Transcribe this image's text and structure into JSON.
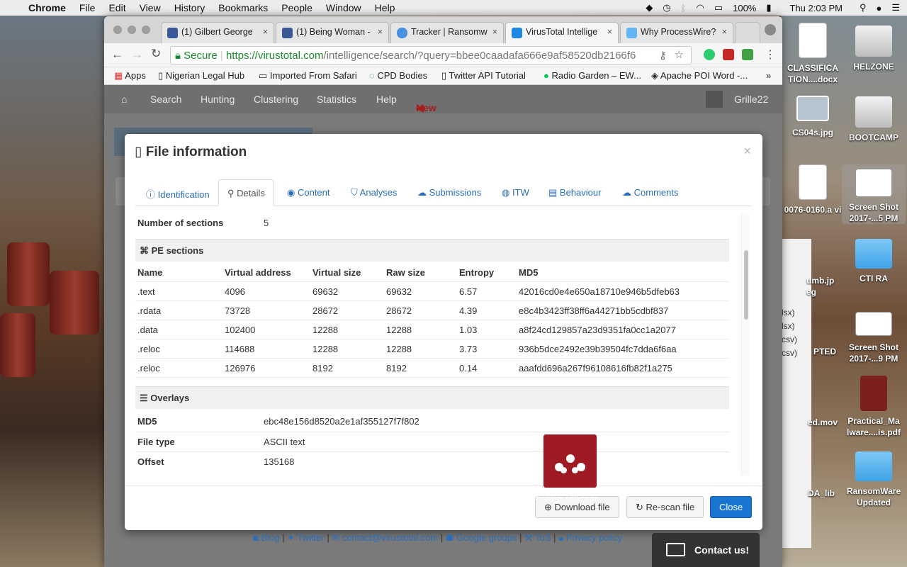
{
  "menubar": {
    "app": "Chrome",
    "items": [
      "File",
      "Edit",
      "View",
      "History",
      "Bookmarks",
      "People",
      "Window",
      "Help"
    ],
    "battery": "100%",
    "clock": "Thu 2:03 PM"
  },
  "tabs": [
    {
      "label": "(1) Gilbert George",
      "icon": "facebook-icon",
      "color": "#3b5998"
    },
    {
      "label": "(1) Being Woman -",
      "icon": "facebook-icon",
      "color": "#3b5998"
    },
    {
      "label": "Tracker | Ransomw",
      "icon": "lock-icon",
      "color": "#4a90e2"
    },
    {
      "label": "VirusTotal Intellige",
      "icon": "virustotal-icon",
      "color": "#1e88e5"
    },
    {
      "label": "Why ProcessWire?",
      "icon": "processwire-icon",
      "color": "#64b5f6"
    }
  ],
  "address": {
    "secure": "Secure",
    "url_host": "https://virustotal.com",
    "url_path": "/intelligence/search/?query=bbee0caadafa666e9af58520db2166f6"
  },
  "bookmarks": [
    "Apps",
    "Nigerian Legal Hub",
    "Imported From Safari",
    "CPD Bodies",
    "Twitter API Tutorial",
    "Radio Garden – EW...",
    "Apache POI Word -..."
  ],
  "vtnav": {
    "items": [
      "Search",
      "Hunting",
      "Clustering",
      "Statistics",
      "Help"
    ],
    "new": "New",
    "user": "Grille22"
  },
  "modal": {
    "title": "File information",
    "close": "×",
    "tabs": [
      "Identification",
      "Details",
      "Content",
      "Analyses",
      "Submissions",
      "ITW",
      "Behaviour",
      "Comments"
    ],
    "active_tab": "Details",
    "sections_label": "Number of sections",
    "sections_value": "5",
    "pe_title": "PE sections",
    "pe_headers": [
      "Name",
      "Virtual address",
      "Virtual size",
      "Raw size",
      "Entropy",
      "MD5"
    ],
    "pe_rows": [
      [
        ".text",
        "4096",
        "69632",
        "69632",
        "6.57",
        "42016cd0e4e650a18710e946b5dfeb63"
      ],
      [
        ".rdata",
        "73728",
        "28672",
        "28672",
        "4.39",
        "e8c4b3423ff38ff6a44271bb5cdbf837"
      ],
      [
        ".data",
        "102400",
        "12288",
        "12288",
        "1.03",
        "a8f24cd129857a23d9351fa0cc1a2077"
      ],
      [
        ".reloc",
        "114688",
        "12288",
        "12288",
        "3.73",
        "936b5dce2492e39b39504fc7dda6f6aa"
      ],
      [
        ".reloc",
        "126976",
        "8192",
        "8192",
        "0.14",
        "aaafdd696a267f96108616fb82f1a275"
      ]
    ],
    "overlays_title": "Overlays",
    "overlay_rows": [
      [
        "MD5",
        "ebc48e156d8520a2e1af355127f7f802"
      ],
      [
        "File type",
        "ASCII text"
      ],
      [
        "Offset",
        "135168"
      ]
    ],
    "buttons": {
      "download": "Download file",
      "rescan": "Re-scan file",
      "close": "Close"
    }
  },
  "page_footer": [
    "Blog",
    "Twitter",
    "contact@virustotal.com",
    "Google groups",
    "ToS",
    "Privacy policy"
  ],
  "contact": "Contact us!",
  "mendeley": "Mendeley Desktop",
  "desktop_icons": [
    {
      "label": "CLASSIFICA TION....docx",
      "kind": "doc"
    },
    {
      "label": "HELZONE",
      "kind": "drive"
    },
    {
      "label": "CS04s.jpg",
      "kind": "image"
    },
    {
      "label": "BOOTCAMP",
      "kind": "drive"
    },
    {
      "label": "0076-0160.a vi",
      "kind": "video"
    },
    {
      "label": "Screen Shot 2017-...5 PM",
      "kind": "image"
    },
    {
      "label": "CTI RA",
      "kind": "folder"
    },
    {
      "label": "Screen Shot 2017-...9 PM",
      "kind": "image"
    },
    {
      "label": "Practical_Ma lware....is.pdf",
      "kind": "pdf"
    },
    {
      "label": "RansomWare Updated",
      "kind": "folder"
    }
  ],
  "finder_fragments": [
    "umb.jp eg",
    "PTED",
    "ed.mov",
    "DA_lib",
    "lsx)",
    "lsx)",
    "csv)",
    "csv)"
  ]
}
